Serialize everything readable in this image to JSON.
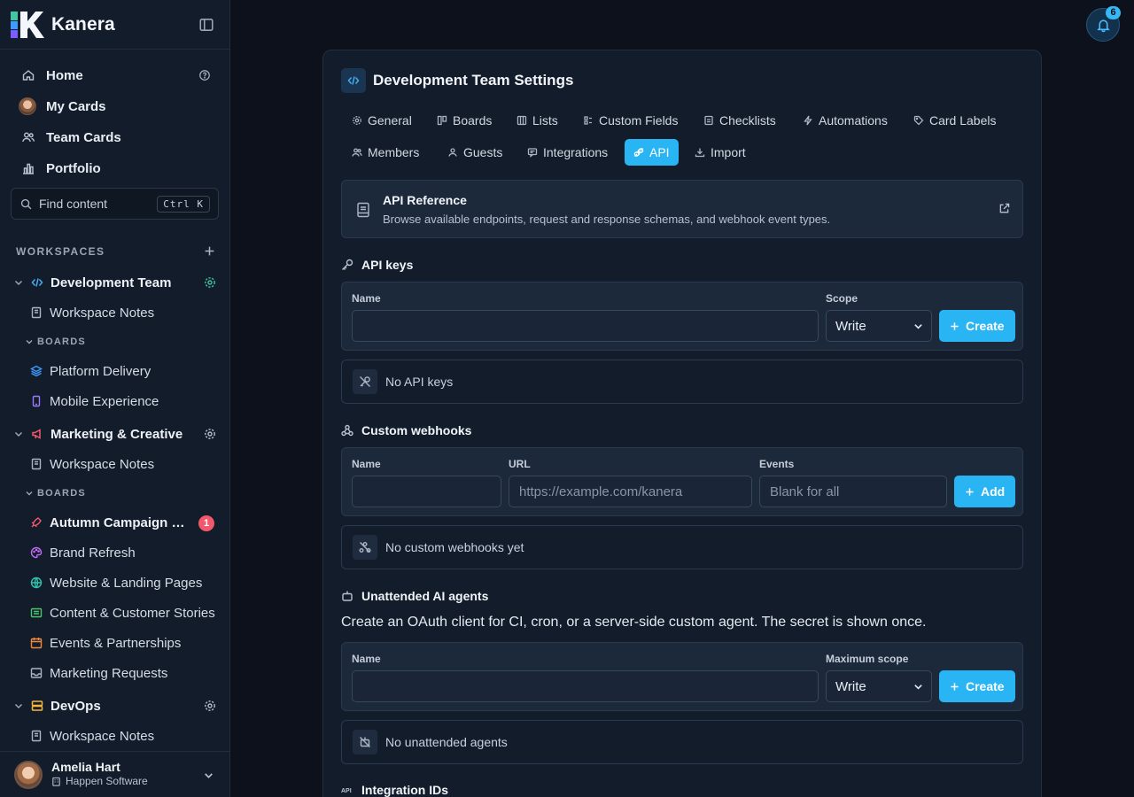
{
  "app": {
    "name": "Kanera"
  },
  "sidebar": {
    "nav": [
      {
        "label": "Home"
      },
      {
        "label": "My Cards"
      },
      {
        "label": "Team Cards"
      },
      {
        "label": "Portfolio"
      }
    ],
    "search": {
      "label": "Find content",
      "shortcut": "Ctrl K"
    },
    "workspaces_label": "WORKSPACES",
    "workspaces": [
      {
        "name": "Development Team",
        "notes": "Workspace Notes",
        "boards_label": "BOARDS",
        "boards": [
          "Platform Delivery",
          "Mobile Experience"
        ]
      },
      {
        "name": "Marketing & Creative",
        "notes": "Workspace Notes",
        "boards_label": "BOARDS",
        "boards": [
          "Autumn Campaign Launch",
          "Brand Refresh",
          "Website & Landing Pages",
          "Content & Customer Stories",
          "Events & Partnerships",
          "Marketing Requests"
        ],
        "badge": "1"
      },
      {
        "name": "DevOps",
        "notes": "Workspace Notes"
      }
    ],
    "user": {
      "name": "Amelia Hart",
      "org": "Happen Software"
    }
  },
  "notifications": {
    "count": "6"
  },
  "settings": {
    "title": "Development Team Settings",
    "tabs": [
      {
        "label": "General"
      },
      {
        "label": "Boards"
      },
      {
        "label": "Lists"
      },
      {
        "label": "Custom Fields"
      },
      {
        "label": "Checklists"
      },
      {
        "label": "Automations"
      },
      {
        "label": "Card Labels"
      },
      {
        "label": "Members"
      },
      {
        "label": "Guests"
      },
      {
        "label": "Integrations"
      },
      {
        "label": "API",
        "active": true
      },
      {
        "label": "Import"
      }
    ],
    "api_reference": {
      "title": "API Reference",
      "description": "Browse available endpoints, request and response schemas, and webhook event types."
    },
    "api_keys": {
      "title": "API keys",
      "name_label": "Name",
      "name_value": "",
      "scope_label": "Scope",
      "scope_value": "Write",
      "create_label": "Create",
      "empty": "No API keys"
    },
    "webhooks": {
      "title": "Custom webhooks",
      "name_label": "Name",
      "url_label": "URL",
      "url_placeholder": "https://example.com/kanera",
      "events_label": "Events",
      "events_placeholder": "Blank for all",
      "add_label": "Add",
      "empty": "No custom webhooks yet"
    },
    "agents": {
      "title": "Unattended AI agents",
      "description": "Create an OAuth client for CI, cron, or a server-side custom agent. The secret is shown once.",
      "name_label": "Name",
      "scope_label": "Maximum scope",
      "scope_value": "Write",
      "create_label": "Create",
      "empty": "No unattended agents"
    },
    "integration_ids": {
      "title": "Integration IDs"
    }
  },
  "colors": {
    "accent": "#29b4f4",
    "badge_red": "#f2586b",
    "background": "#0c111b",
    "sidebar": "#131c2a"
  }
}
